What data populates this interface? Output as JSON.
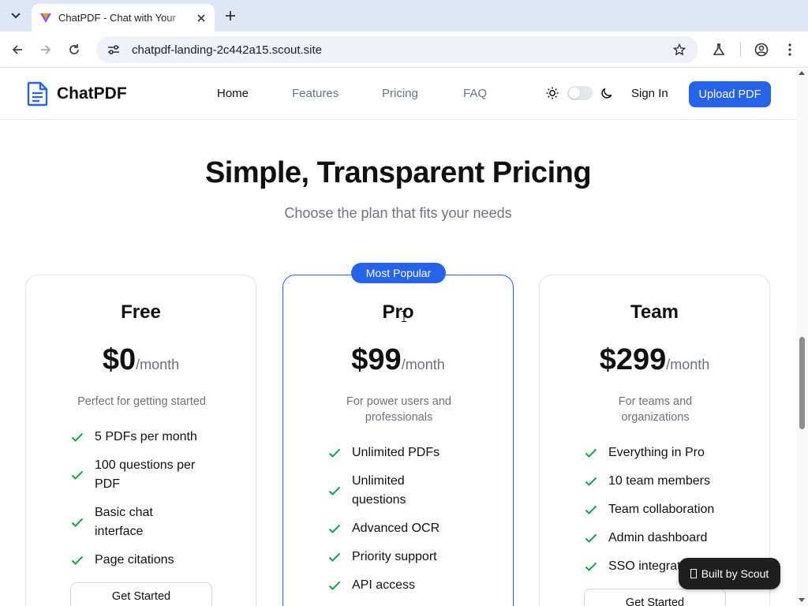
{
  "browser": {
    "tab_title": "ChatPDF - Chat with Your",
    "url": "chatpdf-landing-2c442a15.scout.site"
  },
  "site": {
    "logo_text": "ChatPDF",
    "nav": [
      {
        "label": "Home",
        "active": true
      },
      {
        "label": "Features",
        "active": false
      },
      {
        "label": "Pricing",
        "active": false
      },
      {
        "label": "FAQ",
        "active": false
      }
    ],
    "sign_in": "Sign In",
    "upload": "Upload PDF"
  },
  "pricing": {
    "title": "Simple, Transparent Pricing",
    "subtitle": "Choose the plan that fits your needs",
    "plans": [
      {
        "name": "Free",
        "price": "$0",
        "period": "/month",
        "description": "Perfect for getting started",
        "features": [
          "5 PDFs per month",
          "100 questions per PDF",
          "Basic chat interface",
          "Page citations"
        ],
        "cta": "Get Started"
      },
      {
        "name": "Pro",
        "badge": "Most Popular",
        "price": "$99",
        "period": "/month",
        "description": "For power users and professionals",
        "features": [
          "Unlimited PDFs",
          "Unlimited questions",
          "Advanced OCR",
          "Priority support",
          "API access"
        ],
        "cta": ""
      },
      {
        "name": "Team",
        "price": "$299",
        "period": "/month",
        "description": "For teams and organizations",
        "features": [
          "Everything in Pro",
          "10 team members",
          "Team collaboration",
          "Admin dashboard",
          "SSO integration"
        ],
        "cta": "Get Started"
      }
    ]
  },
  "scout_badge": "Built by Scout",
  "colors": {
    "accent": "#2563eb",
    "check": "#16a34a",
    "muted_text": "#6b7280"
  }
}
